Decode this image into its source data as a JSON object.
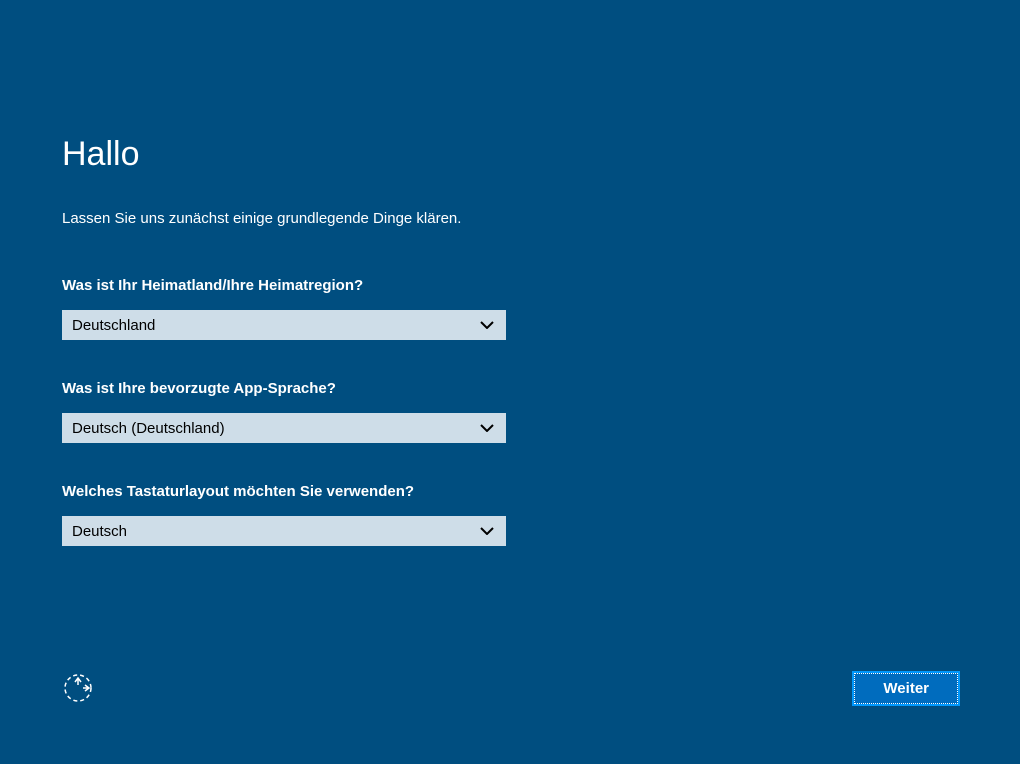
{
  "header": {
    "title": "Hallo",
    "subtitle": "Lassen Sie uns zunächst einige grundlegende Dinge klären."
  },
  "fields": {
    "region": {
      "label": "Was ist Ihr Heimatland/Ihre Heimatregion?",
      "value": "Deutschland"
    },
    "language": {
      "label": "Was ist Ihre bevorzugte App-Sprache?",
      "value": "Deutsch (Deutschland)"
    },
    "keyboard": {
      "label": "Welches Tastaturlayout möchten Sie verwenden?",
      "value": "Deutsch"
    }
  },
  "footer": {
    "next_label": "Weiter"
  }
}
